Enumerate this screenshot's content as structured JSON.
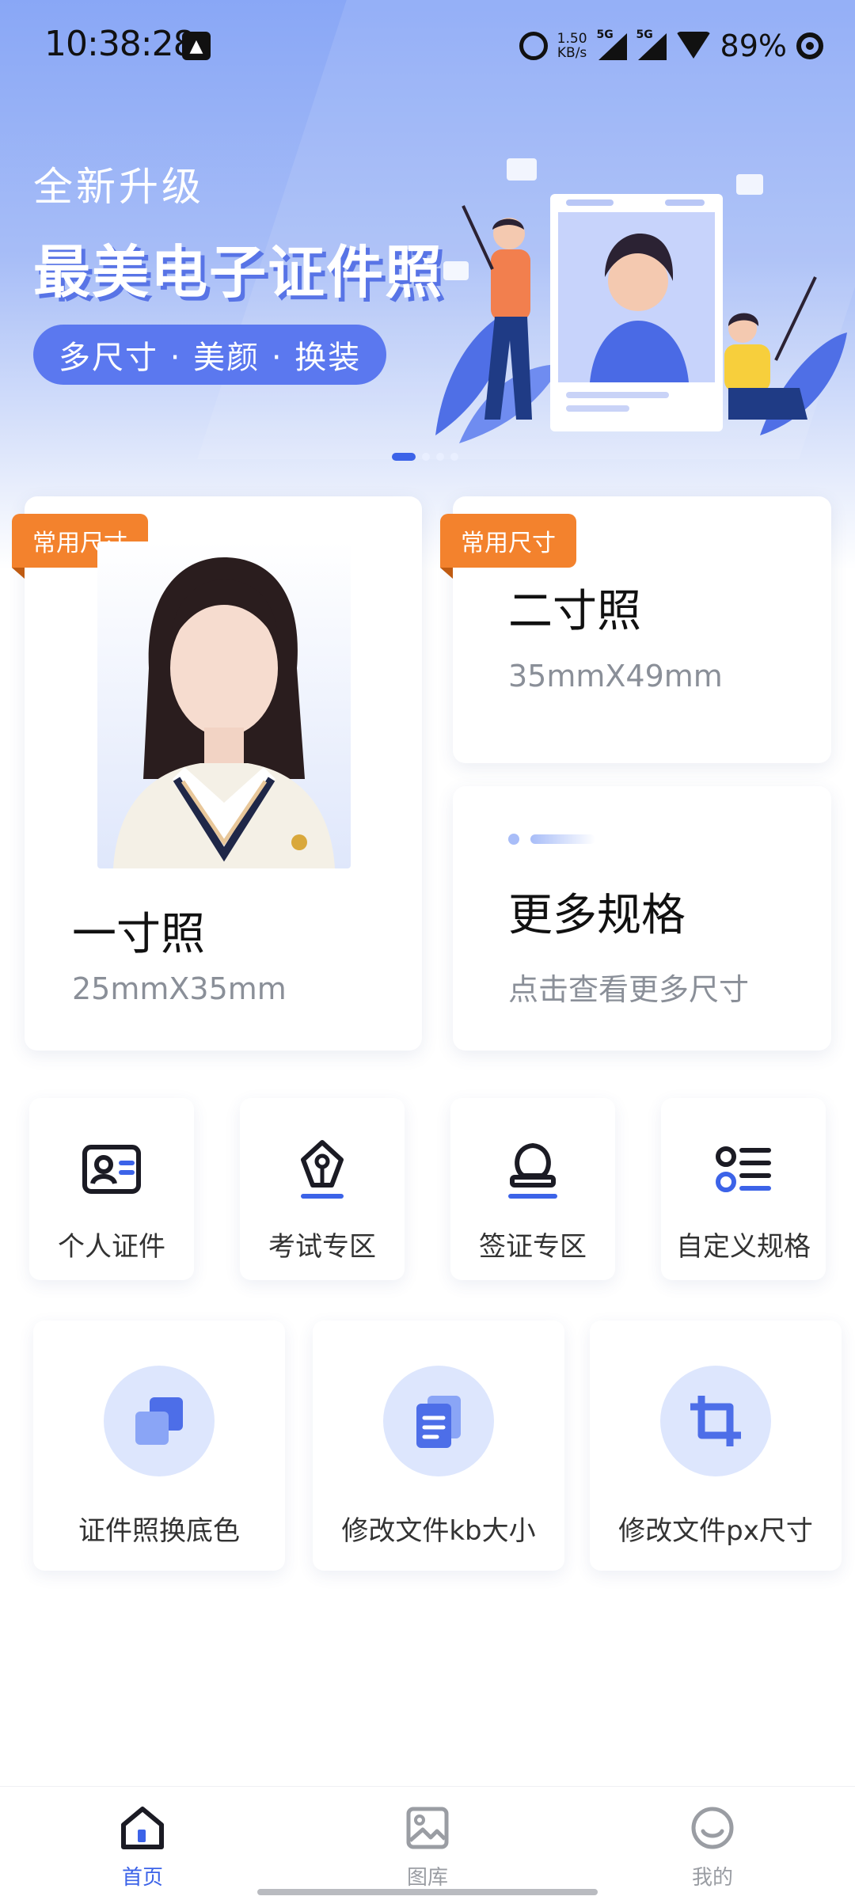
{
  "status_bar": {
    "time": "10:38:28",
    "net_speed_value": "1.50",
    "net_speed_unit": "KB/s",
    "sig1_label": "5G",
    "sig2_label": "5G",
    "battery": "89%"
  },
  "banner": {
    "subtitle": "全新升级",
    "title": "最美电子证件照",
    "pill": "多尺寸 · 美颜 · 换装",
    "page_index": 1,
    "page_count": 4
  },
  "photo_sizes": {
    "one_inch": {
      "badge": "常用尺寸",
      "title": "一寸照",
      "dims": "25mmX35mm"
    },
    "two_inch": {
      "badge": "常用尺寸",
      "title": "二寸照",
      "dims": "35mmX49mm"
    },
    "more": {
      "title": "更多规格",
      "subtitle": "点击查看更多尺寸"
    }
  },
  "categories": [
    {
      "label": "个人证件",
      "icon": "id-card-icon"
    },
    {
      "label": "考试专区",
      "icon": "pen-nib-icon"
    },
    {
      "label": "签证专区",
      "icon": "stamp-icon"
    },
    {
      "label": "自定义规格",
      "icon": "list-icon"
    }
  ],
  "tools": [
    {
      "label": "证件照换底色",
      "icon": "layers-icon"
    },
    {
      "label": "修改文件kb大小",
      "icon": "document-icon"
    },
    {
      "label": "修改文件px尺寸",
      "icon": "crop-icon"
    }
  ],
  "bottom_nav": [
    {
      "label": "首页",
      "icon": "home-icon",
      "active": true
    },
    {
      "label": "图库",
      "icon": "gallery-icon",
      "active": false
    },
    {
      "label": "我的",
      "icon": "profile-icon",
      "active": false
    }
  ],
  "colors": {
    "accent": "#3c63e8",
    "badge": "#f3822d",
    "icon_light": "#dde6fd"
  }
}
